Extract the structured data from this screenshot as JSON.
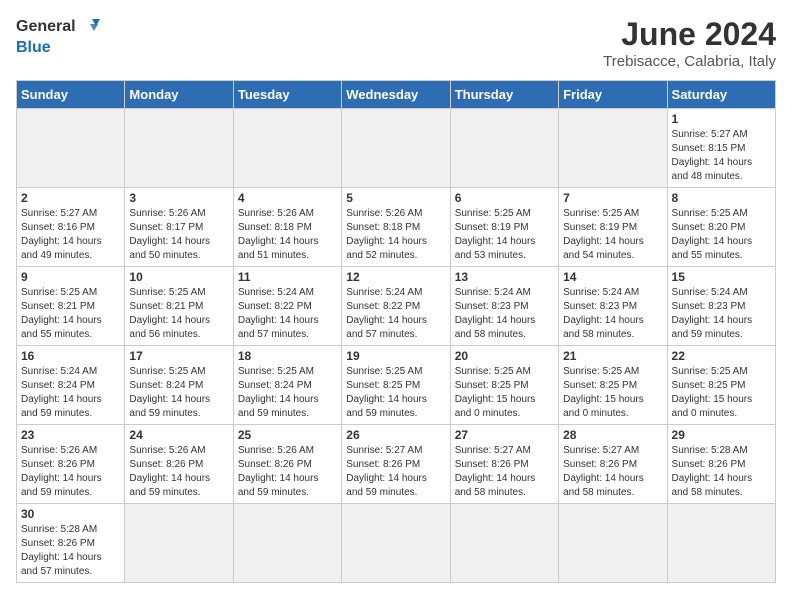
{
  "header": {
    "logo_general": "General",
    "logo_blue": "Blue",
    "month_title": "June 2024",
    "subtitle": "Trebisacce, Calabria, Italy"
  },
  "days_of_week": [
    "Sunday",
    "Monday",
    "Tuesday",
    "Wednesday",
    "Thursday",
    "Friday",
    "Saturday"
  ],
  "weeks": [
    [
      {
        "day": "",
        "info": ""
      },
      {
        "day": "",
        "info": ""
      },
      {
        "day": "",
        "info": ""
      },
      {
        "day": "",
        "info": ""
      },
      {
        "day": "",
        "info": ""
      },
      {
        "day": "",
        "info": ""
      },
      {
        "day": "1",
        "info": "Sunrise: 5:27 AM\nSunset: 8:15 PM\nDaylight: 14 hours and 48 minutes."
      }
    ],
    [
      {
        "day": "2",
        "info": "Sunrise: 5:27 AM\nSunset: 8:16 PM\nDaylight: 14 hours and 49 minutes."
      },
      {
        "day": "3",
        "info": "Sunrise: 5:26 AM\nSunset: 8:17 PM\nDaylight: 14 hours and 50 minutes."
      },
      {
        "day": "4",
        "info": "Sunrise: 5:26 AM\nSunset: 8:18 PM\nDaylight: 14 hours and 51 minutes."
      },
      {
        "day": "5",
        "info": "Sunrise: 5:26 AM\nSunset: 8:18 PM\nDaylight: 14 hours and 52 minutes."
      },
      {
        "day": "6",
        "info": "Sunrise: 5:25 AM\nSunset: 8:19 PM\nDaylight: 14 hours and 53 minutes."
      },
      {
        "day": "7",
        "info": "Sunrise: 5:25 AM\nSunset: 8:19 PM\nDaylight: 14 hours and 54 minutes."
      },
      {
        "day": "8",
        "info": "Sunrise: 5:25 AM\nSunset: 8:20 PM\nDaylight: 14 hours and 55 minutes."
      }
    ],
    [
      {
        "day": "9",
        "info": "Sunrise: 5:25 AM\nSunset: 8:21 PM\nDaylight: 14 hours and 55 minutes."
      },
      {
        "day": "10",
        "info": "Sunrise: 5:25 AM\nSunset: 8:21 PM\nDaylight: 14 hours and 56 minutes."
      },
      {
        "day": "11",
        "info": "Sunrise: 5:24 AM\nSunset: 8:22 PM\nDaylight: 14 hours and 57 minutes."
      },
      {
        "day": "12",
        "info": "Sunrise: 5:24 AM\nSunset: 8:22 PM\nDaylight: 14 hours and 57 minutes."
      },
      {
        "day": "13",
        "info": "Sunrise: 5:24 AM\nSunset: 8:23 PM\nDaylight: 14 hours and 58 minutes."
      },
      {
        "day": "14",
        "info": "Sunrise: 5:24 AM\nSunset: 8:23 PM\nDaylight: 14 hours and 58 minutes."
      },
      {
        "day": "15",
        "info": "Sunrise: 5:24 AM\nSunset: 8:23 PM\nDaylight: 14 hours and 59 minutes."
      }
    ],
    [
      {
        "day": "16",
        "info": "Sunrise: 5:24 AM\nSunset: 8:24 PM\nDaylight: 14 hours and 59 minutes."
      },
      {
        "day": "17",
        "info": "Sunrise: 5:25 AM\nSunset: 8:24 PM\nDaylight: 14 hours and 59 minutes."
      },
      {
        "day": "18",
        "info": "Sunrise: 5:25 AM\nSunset: 8:24 PM\nDaylight: 14 hours and 59 minutes."
      },
      {
        "day": "19",
        "info": "Sunrise: 5:25 AM\nSunset: 8:25 PM\nDaylight: 14 hours and 59 minutes."
      },
      {
        "day": "20",
        "info": "Sunrise: 5:25 AM\nSunset: 8:25 PM\nDaylight: 15 hours and 0 minutes."
      },
      {
        "day": "21",
        "info": "Sunrise: 5:25 AM\nSunset: 8:25 PM\nDaylight: 15 hours and 0 minutes."
      },
      {
        "day": "22",
        "info": "Sunrise: 5:25 AM\nSunset: 8:25 PM\nDaylight: 15 hours and 0 minutes."
      }
    ],
    [
      {
        "day": "23",
        "info": "Sunrise: 5:26 AM\nSunset: 8:26 PM\nDaylight: 14 hours and 59 minutes."
      },
      {
        "day": "24",
        "info": "Sunrise: 5:26 AM\nSunset: 8:26 PM\nDaylight: 14 hours and 59 minutes."
      },
      {
        "day": "25",
        "info": "Sunrise: 5:26 AM\nSunset: 8:26 PM\nDaylight: 14 hours and 59 minutes."
      },
      {
        "day": "26",
        "info": "Sunrise: 5:27 AM\nSunset: 8:26 PM\nDaylight: 14 hours and 59 minutes."
      },
      {
        "day": "27",
        "info": "Sunrise: 5:27 AM\nSunset: 8:26 PM\nDaylight: 14 hours and 58 minutes."
      },
      {
        "day": "28",
        "info": "Sunrise: 5:27 AM\nSunset: 8:26 PM\nDaylight: 14 hours and 58 minutes."
      },
      {
        "day": "29",
        "info": "Sunrise: 5:28 AM\nSunset: 8:26 PM\nDaylight: 14 hours and 58 minutes."
      }
    ],
    [
      {
        "day": "30",
        "info": "Sunrise: 5:28 AM\nSunset: 8:26 PM\nDaylight: 14 hours and 57 minutes."
      },
      {
        "day": "",
        "info": ""
      },
      {
        "day": "",
        "info": ""
      },
      {
        "day": "",
        "info": ""
      },
      {
        "day": "",
        "info": ""
      },
      {
        "day": "",
        "info": ""
      },
      {
        "day": "",
        "info": ""
      }
    ]
  ]
}
